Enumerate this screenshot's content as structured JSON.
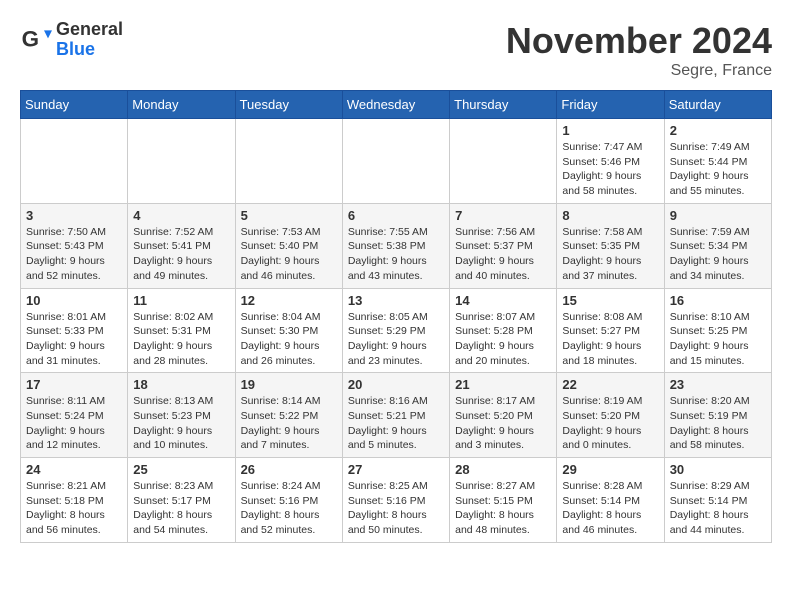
{
  "logo": {
    "general": "General",
    "blue": "Blue"
  },
  "header": {
    "month": "November 2024",
    "location": "Segre, France"
  },
  "weekdays": [
    "Sunday",
    "Monday",
    "Tuesday",
    "Wednesday",
    "Thursday",
    "Friday",
    "Saturday"
  ],
  "weeks": [
    [
      {
        "day": "",
        "info": ""
      },
      {
        "day": "",
        "info": ""
      },
      {
        "day": "",
        "info": ""
      },
      {
        "day": "",
        "info": ""
      },
      {
        "day": "",
        "info": ""
      },
      {
        "day": "1",
        "info": "Sunrise: 7:47 AM\nSunset: 5:46 PM\nDaylight: 9 hours and 58 minutes."
      },
      {
        "day": "2",
        "info": "Sunrise: 7:49 AM\nSunset: 5:44 PM\nDaylight: 9 hours and 55 minutes."
      }
    ],
    [
      {
        "day": "3",
        "info": "Sunrise: 7:50 AM\nSunset: 5:43 PM\nDaylight: 9 hours and 52 minutes."
      },
      {
        "day": "4",
        "info": "Sunrise: 7:52 AM\nSunset: 5:41 PM\nDaylight: 9 hours and 49 minutes."
      },
      {
        "day": "5",
        "info": "Sunrise: 7:53 AM\nSunset: 5:40 PM\nDaylight: 9 hours and 46 minutes."
      },
      {
        "day": "6",
        "info": "Sunrise: 7:55 AM\nSunset: 5:38 PM\nDaylight: 9 hours and 43 minutes."
      },
      {
        "day": "7",
        "info": "Sunrise: 7:56 AM\nSunset: 5:37 PM\nDaylight: 9 hours and 40 minutes."
      },
      {
        "day": "8",
        "info": "Sunrise: 7:58 AM\nSunset: 5:35 PM\nDaylight: 9 hours and 37 minutes."
      },
      {
        "day": "9",
        "info": "Sunrise: 7:59 AM\nSunset: 5:34 PM\nDaylight: 9 hours and 34 minutes."
      }
    ],
    [
      {
        "day": "10",
        "info": "Sunrise: 8:01 AM\nSunset: 5:33 PM\nDaylight: 9 hours and 31 minutes."
      },
      {
        "day": "11",
        "info": "Sunrise: 8:02 AM\nSunset: 5:31 PM\nDaylight: 9 hours and 28 minutes."
      },
      {
        "day": "12",
        "info": "Sunrise: 8:04 AM\nSunset: 5:30 PM\nDaylight: 9 hours and 26 minutes."
      },
      {
        "day": "13",
        "info": "Sunrise: 8:05 AM\nSunset: 5:29 PM\nDaylight: 9 hours and 23 minutes."
      },
      {
        "day": "14",
        "info": "Sunrise: 8:07 AM\nSunset: 5:28 PM\nDaylight: 9 hours and 20 minutes."
      },
      {
        "day": "15",
        "info": "Sunrise: 8:08 AM\nSunset: 5:27 PM\nDaylight: 9 hours and 18 minutes."
      },
      {
        "day": "16",
        "info": "Sunrise: 8:10 AM\nSunset: 5:25 PM\nDaylight: 9 hours and 15 minutes."
      }
    ],
    [
      {
        "day": "17",
        "info": "Sunrise: 8:11 AM\nSunset: 5:24 PM\nDaylight: 9 hours and 12 minutes."
      },
      {
        "day": "18",
        "info": "Sunrise: 8:13 AM\nSunset: 5:23 PM\nDaylight: 9 hours and 10 minutes."
      },
      {
        "day": "19",
        "info": "Sunrise: 8:14 AM\nSunset: 5:22 PM\nDaylight: 9 hours and 7 minutes."
      },
      {
        "day": "20",
        "info": "Sunrise: 8:16 AM\nSunset: 5:21 PM\nDaylight: 9 hours and 5 minutes."
      },
      {
        "day": "21",
        "info": "Sunrise: 8:17 AM\nSunset: 5:20 PM\nDaylight: 9 hours and 3 minutes."
      },
      {
        "day": "22",
        "info": "Sunrise: 8:19 AM\nSunset: 5:20 PM\nDaylight: 9 hours and 0 minutes."
      },
      {
        "day": "23",
        "info": "Sunrise: 8:20 AM\nSunset: 5:19 PM\nDaylight: 8 hours and 58 minutes."
      }
    ],
    [
      {
        "day": "24",
        "info": "Sunrise: 8:21 AM\nSunset: 5:18 PM\nDaylight: 8 hours and 56 minutes."
      },
      {
        "day": "25",
        "info": "Sunrise: 8:23 AM\nSunset: 5:17 PM\nDaylight: 8 hours and 54 minutes."
      },
      {
        "day": "26",
        "info": "Sunrise: 8:24 AM\nSunset: 5:16 PM\nDaylight: 8 hours and 52 minutes."
      },
      {
        "day": "27",
        "info": "Sunrise: 8:25 AM\nSunset: 5:16 PM\nDaylight: 8 hours and 50 minutes."
      },
      {
        "day": "28",
        "info": "Sunrise: 8:27 AM\nSunset: 5:15 PM\nDaylight: 8 hours and 48 minutes."
      },
      {
        "day": "29",
        "info": "Sunrise: 8:28 AM\nSunset: 5:14 PM\nDaylight: 8 hours and 46 minutes."
      },
      {
        "day": "30",
        "info": "Sunrise: 8:29 AM\nSunset: 5:14 PM\nDaylight: 8 hours and 44 minutes."
      }
    ]
  ]
}
